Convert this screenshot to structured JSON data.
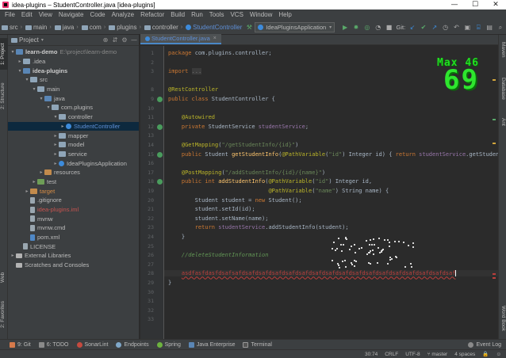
{
  "window": {
    "title": "idea-plugins – StudentController.java [idea-plugins]",
    "controls": [
      "—",
      "☐",
      "✕"
    ]
  },
  "menu": [
    "File",
    "Edit",
    "View",
    "Navigate",
    "Code",
    "Analyze",
    "Refactor",
    "Build",
    "Run",
    "Tools",
    "VCS",
    "Window",
    "Help"
  ],
  "breadcrumbs": [
    "src",
    "main",
    "java",
    "com",
    "plugins",
    "controller",
    "StudentController"
  ],
  "toolbar": {
    "run_config": "IdeaPluginsApplication",
    "git_label": "Git:"
  },
  "left_tabs": [
    "1: Project",
    "2: Structure",
    "Web",
    "2: Favorites"
  ],
  "right_tabs": [
    "Maven",
    "Database",
    "Ant",
    "Word Book"
  ],
  "project": {
    "title": "Project",
    "tree": [
      {
        "depth": 0,
        "arrow": "▾",
        "icon": "folder-blue",
        "label": "learn-demo",
        "path": "E:\\project\\learn-demo",
        "style": "bold"
      },
      {
        "depth": 1,
        "arrow": "▸",
        "icon": "folder",
        "label": ".idea",
        "style": ""
      },
      {
        "depth": 1,
        "arrow": "▾",
        "icon": "folder-blue",
        "label": "idea-plugins",
        "style": "bold"
      },
      {
        "depth": 2,
        "arrow": "▾",
        "icon": "folder",
        "label": "src",
        "style": ""
      },
      {
        "depth": 3,
        "arrow": "▾",
        "icon": "folder",
        "label": "main",
        "style": ""
      },
      {
        "depth": 4,
        "arrow": "▾",
        "icon": "folder-blue",
        "label": "java",
        "style": ""
      },
      {
        "depth": 5,
        "arrow": "▾",
        "icon": "pkg",
        "label": "com.plugins",
        "style": ""
      },
      {
        "depth": 6,
        "arrow": "▾",
        "icon": "pkg",
        "label": "controller",
        "style": ""
      },
      {
        "depth": 7,
        "arrow": "▸",
        "icon": "java",
        "label": "StudentController",
        "style": "blue",
        "selected": true
      },
      {
        "depth": 6,
        "arrow": "▸",
        "icon": "pkg",
        "label": "mapper",
        "style": ""
      },
      {
        "depth": 6,
        "arrow": "▸",
        "icon": "pkg",
        "label": "model",
        "style": ""
      },
      {
        "depth": 6,
        "arrow": "▸",
        "icon": "pkg",
        "label": "service",
        "style": ""
      },
      {
        "depth": 6,
        "arrow": "▸",
        "icon": "java",
        "label": "IdeaPluginsApplication",
        "style": ""
      },
      {
        "depth": 4,
        "arrow": "▸",
        "icon": "folder-orange",
        "label": "resources",
        "style": ""
      },
      {
        "depth": 3,
        "arrow": "▸",
        "icon": "folder-green",
        "label": "test",
        "style": ""
      },
      {
        "depth": 2,
        "arrow": "▸",
        "icon": "folder-orange",
        "label": "target",
        "style": "orange"
      },
      {
        "depth": 2,
        "arrow": "",
        "icon": "file",
        "label": ".gitignore",
        "style": ""
      },
      {
        "depth": 2,
        "arrow": "",
        "icon": "file",
        "label": "idea-plugins.iml",
        "style": "red"
      },
      {
        "depth": 2,
        "arrow": "",
        "icon": "file",
        "label": "mvnw",
        "style": ""
      },
      {
        "depth": 2,
        "arrow": "",
        "icon": "file",
        "label": "mvnw.cmd",
        "style": ""
      },
      {
        "depth": 2,
        "arrow": "",
        "icon": "mfile",
        "label": "pom.xml",
        "style": ""
      },
      {
        "depth": 1,
        "arrow": "",
        "icon": "file",
        "label": "LICENSE",
        "style": ""
      },
      {
        "depth": 0,
        "arrow": "▸",
        "icon": "lib",
        "label": "External Libraries",
        "style": ""
      },
      {
        "depth": 0,
        "arrow": "",
        "icon": "lib",
        "label": "Scratches and Consoles",
        "style": ""
      }
    ]
  },
  "editor": {
    "tab_label": "StudentController.java",
    "line_numbers": [
      "1",
      "2",
      "3",
      "",
      "8",
      "9",
      "10",
      "11",
      "12",
      "13",
      "14",
      "15",
      "16",
      "17",
      "18",
      "19",
      "20",
      "21",
      "22",
      "23",
      "24",
      "25",
      "26",
      "27",
      "28",
      "29",
      "30",
      "31",
      "32",
      "33"
    ],
    "lines": [
      [
        {
          "c": "kw",
          "t": "package "
        },
        {
          "c": "",
          "t": "com.plugins.controller;"
        }
      ],
      [],
      [
        {
          "c": "kw",
          "t": "import "
        },
        {
          "c": "hint",
          "t": "..."
        }
      ],
      [],
      [
        {
          "c": "an",
          "t": "@RestController"
        }
      ],
      [
        {
          "c": "kw",
          "t": "public class "
        },
        {
          "c": "",
          "t": "StudentController {"
        }
      ],
      [],
      [
        {
          "c": "",
          "t": "    "
        },
        {
          "c": "an",
          "t": "@Autowired"
        }
      ],
      [
        {
          "c": "",
          "t": "    "
        },
        {
          "c": "kw",
          "t": "private "
        },
        {
          "c": "",
          "t": "StudentService "
        },
        {
          "c": "fd",
          "t": "studentService"
        },
        {
          "c": "",
          "t": ";"
        }
      ],
      [],
      [
        {
          "c": "",
          "t": "    "
        },
        {
          "c": "an",
          "t": "@GetMapping"
        },
        {
          "c": "",
          "t": "("
        },
        {
          "c": "st",
          "t": "\"/getStudentInfo/{id}\""
        },
        {
          "c": "",
          "t": ")"
        }
      ],
      [
        {
          "c": "",
          "t": "    "
        },
        {
          "c": "kw",
          "t": "public "
        },
        {
          "c": "",
          "t": "Student "
        },
        {
          "c": "fn",
          "t": "getStudentInfo"
        },
        {
          "c": "",
          "t": "("
        },
        {
          "c": "an",
          "t": "@PathVariable"
        },
        {
          "c": "",
          "t": "("
        },
        {
          "c": "st",
          "t": "\"id\""
        },
        {
          "c": "",
          "t": ") Integer id) { "
        },
        {
          "c": "kw",
          "t": "return "
        },
        {
          "c": "fd",
          "t": "studentService"
        },
        {
          "c": "",
          "t": ".getStudent"
        }
      ],
      [],
      [
        {
          "c": "",
          "t": "    "
        },
        {
          "c": "an",
          "t": "@PostMapping"
        },
        {
          "c": "",
          "t": "("
        },
        {
          "c": "st",
          "t": "\"/addStudentInfo/{id}/{name}\""
        },
        {
          "c": "",
          "t": ")"
        }
      ],
      [
        {
          "c": "",
          "t": "    "
        },
        {
          "c": "kw",
          "t": "public int "
        },
        {
          "c": "fn",
          "t": "addStudentInfo"
        },
        {
          "c": "",
          "t": "("
        },
        {
          "c": "an",
          "t": "@PathVariable"
        },
        {
          "c": "",
          "t": "("
        },
        {
          "c": "st",
          "t": "\"id\""
        },
        {
          "c": "",
          "t": ") Integer id,"
        }
      ],
      [
        {
          "c": "",
          "t": "                              "
        },
        {
          "c": "an",
          "t": "@PathVariable"
        },
        {
          "c": "",
          "t": "("
        },
        {
          "c": "st",
          "t": "\"name\""
        },
        {
          "c": "",
          "t": ") String name) {"
        }
      ],
      [
        {
          "c": "",
          "t": "        Student student = "
        },
        {
          "c": "kw",
          "t": "new "
        },
        {
          "c": "",
          "t": "Student();"
        }
      ],
      [
        {
          "c": "",
          "t": "        student.setId(id);"
        }
      ],
      [
        {
          "c": "",
          "t": "        student.setName(name);"
        }
      ],
      [
        {
          "c": "",
          "t": "        "
        },
        {
          "c": "kw",
          "t": "return "
        },
        {
          "c": "fd",
          "t": "studentService"
        },
        {
          "c": "",
          "t": ".addStudentInfo(student);"
        }
      ],
      [
        {
          "c": "",
          "t": "    }"
        }
      ],
      [],
      [
        {
          "c": "",
          "t": "    "
        },
        {
          "c": "cm",
          "t": "//deleteStudentInformation"
        }
      ],
      [],
      [
        {
          "c": "",
          "t": "    "
        },
        {
          "c": "err",
          "t": "asdfasfdasfdsafsafdsafdsafdsafdsafdsafdsafdsafdsafdsafdsafdsafdsafdsafdsafdsafdsaf"
        },
        {
          "c": "caret",
          "t": ""
        }
      ],
      [
        {
          "c": "",
          "t": "}"
        }
      ],
      [],
      [],
      [],
      []
    ]
  },
  "power_mode": {
    "max_label": "Max 46",
    "combo": "69"
  },
  "bottom_tabs": [
    "9: Git",
    "6: TODO",
    "SonarLint",
    "Endpoints",
    "Spring",
    "Java Enterprise",
    "Terminal"
  ],
  "event_log": "Event Log",
  "status": [
    "30:74",
    "CRLF",
    "UTF-8",
    "master",
    "4 spaces"
  ],
  "colors": {
    "accent": "#4a88c7",
    "editor_bg": "#2b2b2b",
    "panel_bg": "#3c3f41",
    "combo_green": "#2ee62e"
  }
}
